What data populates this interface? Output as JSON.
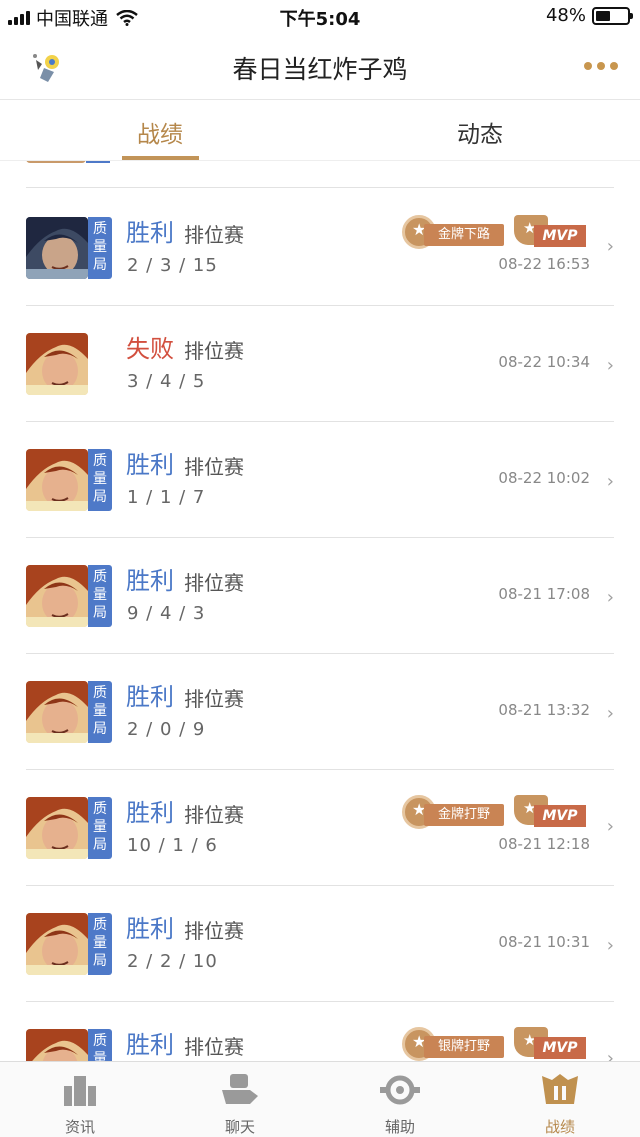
{
  "status_bar": {
    "carrier": "中国联通",
    "time": "下午5:04",
    "battery": "48%",
    "battery_level": 0.48
  },
  "nav": {
    "title": "春日当红炸子鸡"
  },
  "tabs": [
    {
      "label": "战绩",
      "active": true
    },
    {
      "label": "动态",
      "active": false
    }
  ],
  "quality_label": "质量局",
  "mvp_label": "MVP",
  "matches": [
    {
      "result": "胜利",
      "win": true,
      "mode": "排位赛",
      "kda": "2 / 3 / 15",
      "time": "08-22 16:53",
      "quality": true,
      "medal": "金牌下路",
      "mvp": true
    },
    {
      "result": "失败",
      "win": false,
      "mode": "排位赛",
      "kda": "3 / 4 / 5",
      "time": "08-22 10:34",
      "quality": false,
      "medal": "",
      "mvp": false
    },
    {
      "result": "胜利",
      "win": true,
      "mode": "排位赛",
      "kda": "1 / 1 / 7",
      "time": "08-22 10:02",
      "quality": true,
      "medal": "",
      "mvp": false
    },
    {
      "result": "胜利",
      "win": true,
      "mode": "排位赛",
      "kda": "9 / 4 / 3",
      "time": "08-21 17:08",
      "quality": true,
      "medal": "",
      "mvp": false
    },
    {
      "result": "胜利",
      "win": true,
      "mode": "排位赛",
      "kda": "2 / 0 / 9",
      "time": "08-21 13:32",
      "quality": true,
      "medal": "",
      "mvp": false
    },
    {
      "result": "胜利",
      "win": true,
      "mode": "排位赛",
      "kda": "10 / 1 / 6",
      "time": "08-21 12:18",
      "quality": true,
      "medal": "金牌打野",
      "mvp": true
    },
    {
      "result": "胜利",
      "win": true,
      "mode": "排位赛",
      "kda": "2 / 2 / 10",
      "time": "08-21 10:31",
      "quality": true,
      "medal": "",
      "mvp": false
    },
    {
      "result": "胜利",
      "win": true,
      "mode": "排位赛",
      "kda": "",
      "time": "",
      "quality": true,
      "medal": "银牌打野",
      "mvp": true
    }
  ],
  "tabbar": [
    {
      "label": "资讯",
      "icon": "news-icon",
      "active": false
    },
    {
      "label": "聊天",
      "icon": "chat-icon",
      "active": false
    },
    {
      "label": "辅助",
      "icon": "assist-icon",
      "active": false
    },
    {
      "label": "战绩",
      "icon": "record-icon",
      "active": true
    }
  ]
}
